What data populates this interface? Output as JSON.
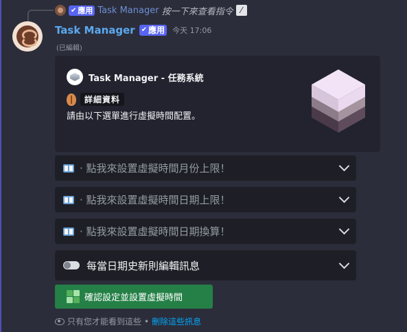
{
  "reply": {
    "badge": "應用",
    "author": "Task Manager",
    "text": "按一下來查看指令"
  },
  "message": {
    "author": "Task Manager",
    "badge": "應用",
    "timestamp": "今天 17:06",
    "edited": "(已編輯)"
  },
  "embed": {
    "title": "Task Manager - 任務系統",
    "section_label": "詳細資料",
    "description": "請由以下選單進行虛擬時間配置。"
  },
  "selects": [
    {
      "icon": "book-icon",
      "placeholder": "· 點我來設置虛擬時間月份上限！"
    },
    {
      "icon": "book-icon",
      "placeholder": "· 點我來設置虛擬時間日期上限！"
    },
    {
      "icon": "book-icon",
      "placeholder": "· 點我來設置虛擬時間日期換算！"
    },
    {
      "icon": "toggle-icon",
      "placeholder": "每當日期史新則編輯訊息"
    }
  ],
  "confirm_button": {
    "label": "確認設定並設置虛擬時間"
  },
  "footer": {
    "text": "只有您才能看到這些",
    "separator": "•",
    "link": "刪除這些訊息"
  },
  "colors": {
    "background": "#2c2d3a",
    "embed_bg": "#22232e",
    "select_bg": "#1e1f26",
    "brand_badge": "#5865f2",
    "author_name": "#5aa9f0",
    "success_button": "#248046",
    "link": "#00a8fc"
  }
}
